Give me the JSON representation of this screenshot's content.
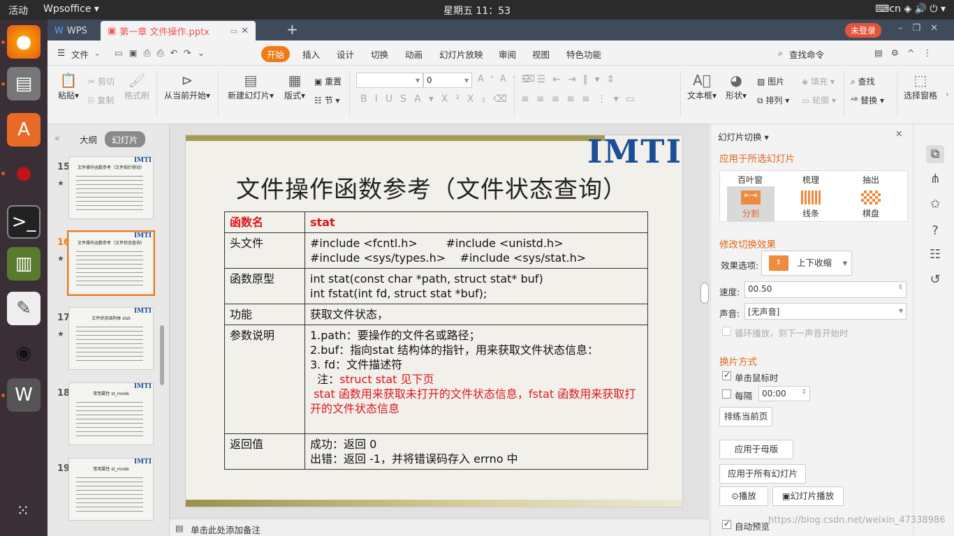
{
  "topbar": {
    "activities": "活动",
    "app": "Wpsoffice ▾",
    "clock": "星期五 11：53",
    "indicators": "⌨cn   ◈  🔊  ⏻ ▾"
  },
  "tabs": {
    "home": "WPS",
    "doc": "第一章 文件操作.pptx",
    "login": "未登录"
  },
  "menu": {
    "file": "文件",
    "items": [
      "开始",
      "插入",
      "设计",
      "切换",
      "动画",
      "幻灯片放映",
      "审阅",
      "视图",
      "特色功能"
    ],
    "search": "查找命令"
  },
  "toolbar": {
    "paste": "粘贴",
    "cut": "剪切",
    "copy": "复制",
    "format_painter": "格式刷",
    "play_from_current": "从当前开始",
    "new_slide": "新建幻灯片",
    "layout": "版式",
    "reset": "重置",
    "section": "节",
    "font_size": "0",
    "textbox": "文本框",
    "shape": "形状",
    "picture": "图片",
    "arrange": "排列",
    "fill": "填充",
    "outline": "轮廓",
    "find": "查找",
    "replace": "替换",
    "select_pane": "选择窗格"
  },
  "left_panel": {
    "tab_outline": "大纲",
    "tab_slides": "幻灯片",
    "thumbs": [
      {
        "num": "15",
        "title": "文件操作函数参考（文件指针移动）",
        "starred": true,
        "selected": false
      },
      {
        "num": "16",
        "title": "文件操作函数参考（文件状态查询）",
        "starred": true,
        "selected": true
      },
      {
        "num": "17",
        "title": "文件状态结构体 stat",
        "starred": true,
        "selected": false
      },
      {
        "num": "18",
        "title": "常用属性 st_mode",
        "starred": false,
        "selected": false
      },
      {
        "num": "19",
        "title": "常用属性 st_mode",
        "starred": false,
        "selected": false
      }
    ],
    "logo": "IMTI"
  },
  "slide": {
    "logo": "IMTI",
    "title": "文件操作函数参考（文件状态查询）",
    "rows": [
      {
        "key": "函数名",
        "value": [
          "stat"
        ]
      },
      {
        "key": "头文件",
        "value": [
          "#include <fcntl.h>        #include <unistd.h>",
          "#include <sys/types.h>    #include <sys/stat.h>"
        ]
      },
      {
        "key": "函数原型",
        "value": [
          "int stat(const char *path, struct stat* buf)",
          "int fstat(int fd, struct stat *buf);"
        ]
      },
      {
        "key": "功能",
        "value": [
          "获取文件状态，"
        ]
      },
      {
        "key": "参数说明",
        "value": [
          "1.path：要操作的文件名或路径；",
          "2.buf：指向stat 结构体的指针，用来获取文件状态信息：",
          "3.  fd：文件描述符"
        ],
        "note1_prefix": "  注：",
        "note1_red": "struct stat 见下页",
        "note2_red": " stat 函数用来获取未打开的文件状态信息，fstat 函数用来获取打开的文件状态信息"
      },
      {
        "key": "返回值",
        "value": [
          "成功：返回 0",
          "出错：返回 -1，并将错误码存入 errno 中"
        ]
      }
    ]
  },
  "notes": "单击此处添加备注",
  "right_panel": {
    "header": "幻灯片切换 ▾",
    "apply_selected": "应用于所选幻灯片",
    "transitions": [
      "百叶窗",
      "梳理",
      "抽出",
      "分割",
      "线条",
      "棋盘"
    ],
    "modify": "修改切换效果",
    "effect_label": "效果选项:",
    "effect_value": "上下收缩",
    "speed_label": "速度:",
    "speed_value": "00.50",
    "sound_label": "声音:",
    "sound_value": "[无声音]",
    "loop_label": "循环播放，到下一声音开始时",
    "advance": "换片方式",
    "on_click": "单击鼠标时",
    "every": "每隔",
    "every_value": "00:00",
    "rehearse": "排练当前页",
    "apply_master": "应用于母版",
    "apply_all": "应用于所有幻灯片",
    "play": "播放",
    "slideshow": "幻灯片播放",
    "auto_preview": "自动预览"
  },
  "watermark": "https://blog.csdn.net/weixin_47338986"
}
